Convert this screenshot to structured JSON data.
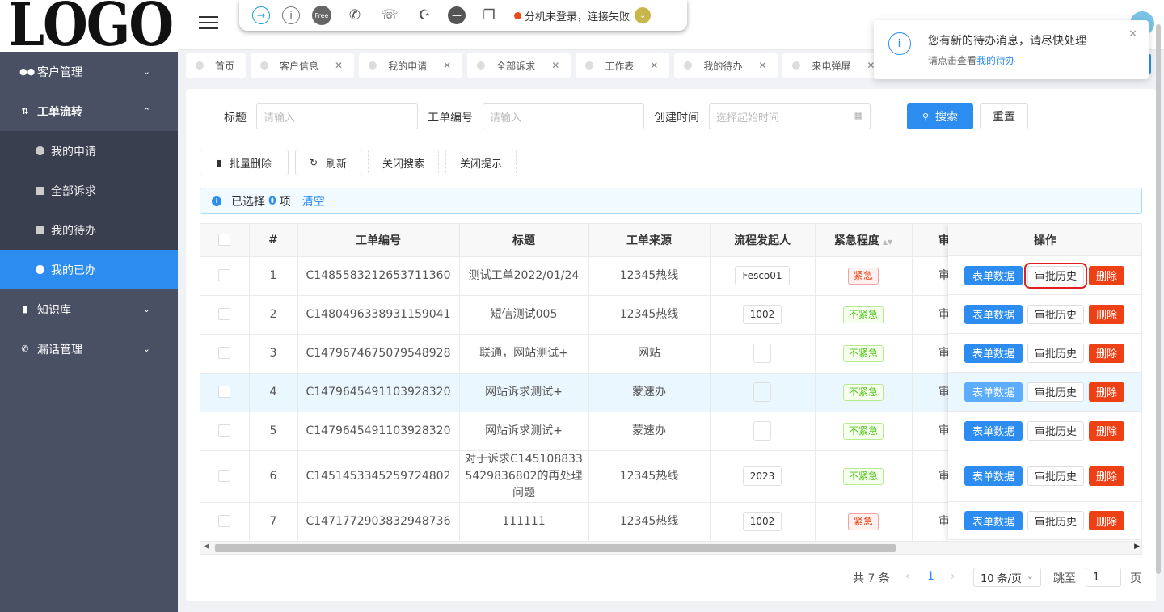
{
  "logo": "LOGO",
  "sidebar": {
    "items": [
      {
        "label": "客户管理",
        "icon": "users-icon"
      },
      {
        "label": "工单流转",
        "icon": "exchange-icon"
      },
      {
        "label": "知识库",
        "icon": "book-icon"
      },
      {
        "label": "漏话管理",
        "icon": "phone-icon"
      }
    ],
    "submenu": [
      {
        "label": "我的申请"
      },
      {
        "label": "全部诉求"
      },
      {
        "label": "我的待办"
      },
      {
        "label": "我的已办"
      }
    ]
  },
  "phonebar": {
    "free_label": "Free",
    "status": "分机未登录，连接失败"
  },
  "tabs": [
    {
      "label": "首页",
      "closable": false
    },
    {
      "label": "客户信息"
    },
    {
      "label": "我的申请"
    },
    {
      "label": "全部诉求"
    },
    {
      "label": "工作表"
    },
    {
      "label": "我的待办"
    },
    {
      "label": "来电弹屏"
    }
  ],
  "notification": {
    "title": "您有新的待办消息，请尽快处理",
    "desc_prefix": "请点击查看",
    "desc_link": "我的待办"
  },
  "filter": {
    "title_label": "标题",
    "title_placeholder": "请输入",
    "number_label": "工单编号",
    "number_placeholder": "请输入",
    "time_label": "创建时间",
    "time_placeholder": "选择起始时间",
    "search": "搜索",
    "reset": "重置"
  },
  "toolbar": {
    "batch_delete": "批量删除",
    "refresh": "刷新",
    "close_search": "关闭搜索",
    "close_tip": "关闭提示"
  },
  "alert": {
    "prefix": "已选择",
    "count": "0",
    "suffix": "项",
    "clear": "清空"
  },
  "table": {
    "headers": [
      "#",
      "工单编号",
      "标题",
      "工单来源",
      "流程发起人",
      "紧急程度",
      "审",
      "操作"
    ],
    "rows": [
      {
        "idx": "1",
        "number": "C1485583212653711360",
        "title": "测试工单2022/01/24",
        "source": "12345热线",
        "initiator": "Fesco01",
        "urgency": "紧急",
        "status": "审"
      },
      {
        "idx": "2",
        "number": "C1480496338931159041",
        "title": "短信测试005",
        "source": "12345热线",
        "initiator": "1002",
        "urgency": "不紧急",
        "status": "审"
      },
      {
        "idx": "3",
        "number": "C1479674675079548928",
        "title": "联通，网站测试+",
        "source": "网站",
        "initiator": "",
        "urgency": "不紧急",
        "status": "审"
      },
      {
        "idx": "4",
        "number": "C1479645491103928320",
        "title": "网站诉求测试+",
        "source": "蒙速办",
        "initiator": "",
        "urgency": "不紧急",
        "status": "审"
      },
      {
        "idx": "5",
        "number": "C1479645491103928320",
        "title": "网站诉求测试+",
        "source": "蒙速办",
        "initiator": "",
        "urgency": "不紧急",
        "status": "审"
      },
      {
        "idx": "6",
        "number": "C1451453345259724802",
        "title": "对于诉求C1451088335429836802的再处理问题",
        "source": "12345热线",
        "initiator": "2023",
        "urgency": "不紧急",
        "status": "审"
      },
      {
        "idx": "7",
        "number": "C1471772903832948736",
        "title": "111111",
        "source": "12345热线",
        "initiator": "1002",
        "urgency": "紧急",
        "status": "审"
      }
    ],
    "ops": {
      "form": "表单数据",
      "history": "审批历史",
      "delete": "删除"
    }
  },
  "pager": {
    "total": "共 7 条",
    "current": "1",
    "size": "10 条/页",
    "jump": "跳至",
    "jump_value": "1",
    "page_unit": "页"
  }
}
